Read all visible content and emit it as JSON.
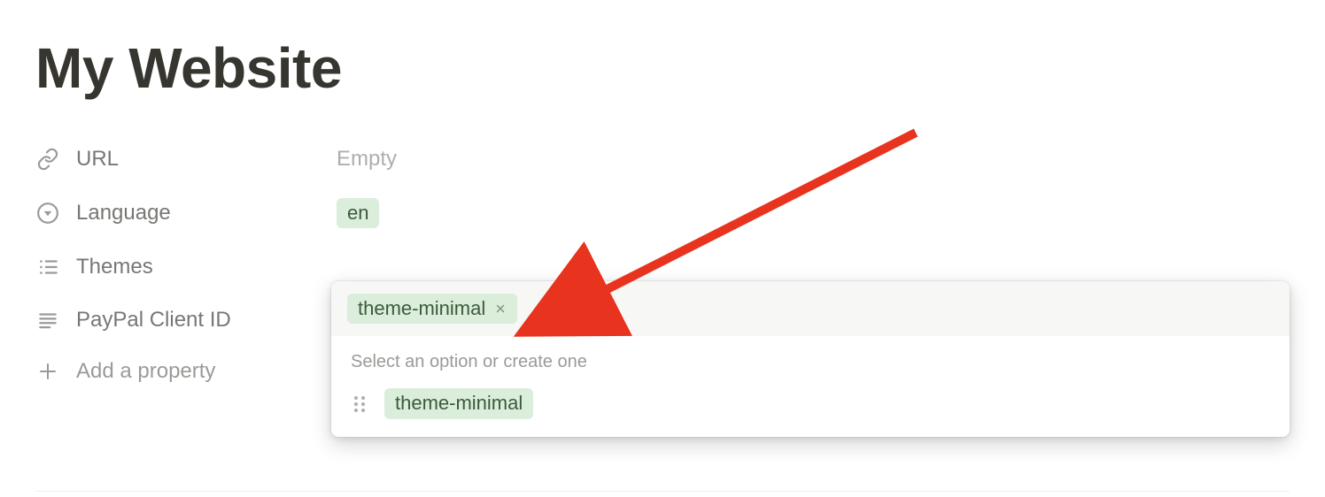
{
  "title": "My Website",
  "properties": {
    "url": {
      "label": "URL",
      "value": "",
      "placeholder": "Empty"
    },
    "language": {
      "label": "Language",
      "value": "en"
    },
    "themes": {
      "label": "Themes",
      "selected": [
        "theme-minimal"
      ]
    },
    "paypal": {
      "label": "PayPal Client ID",
      "value": ""
    }
  },
  "add_property_label": "Add a property",
  "popover": {
    "hint": "Select an option or create one",
    "options": [
      "theme-minimal"
    ],
    "input_value": ""
  }
}
